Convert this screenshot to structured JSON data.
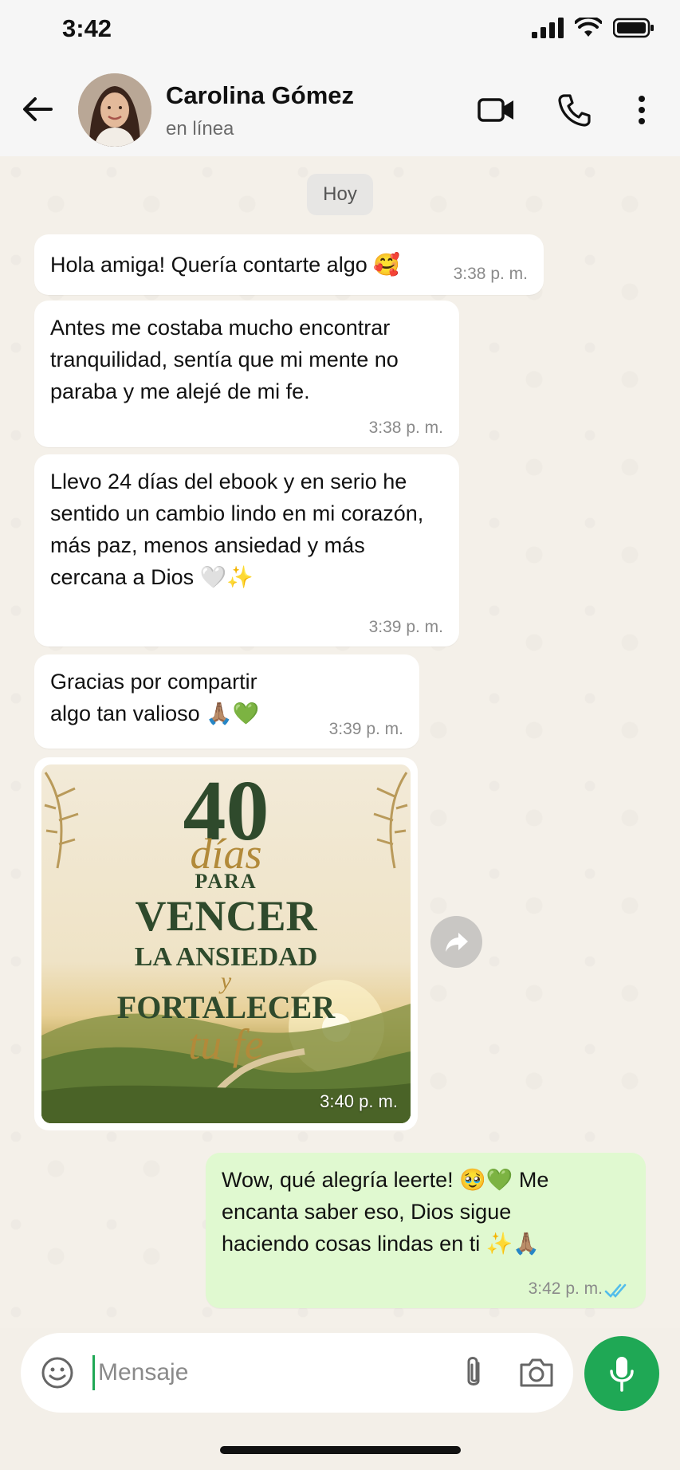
{
  "status_bar": {
    "time": "3:42"
  },
  "header": {
    "contact_name": "Carolina Gómez",
    "contact_status": "en línea"
  },
  "date_chip": "Hoy",
  "messages": [
    {
      "text": "Hola amiga! Quería contarte algo 🥰",
      "time": "3:38 p. m.",
      "direction": "in"
    },
    {
      "text": "Antes me costaba mucho encontrar tranquilidad, sentía que mi mente no paraba y me alejé de mi fe.",
      "time": "3:38 p. m.",
      "direction": "in"
    },
    {
      "text": "Llevo 24 días del ebook y en serio he sentido un cambio lindo en mi corazón, más paz, menos ansiedad y más cercana a Dios 🤍✨",
      "time": "3:39 p. m.",
      "direction": "in"
    },
    {
      "text": "Gracias por compartir algo tan valioso 🙏🏽💚",
      "time": "3:39 p. m.",
      "direction": "in"
    },
    {
      "text": "Wow, qué alegría leerte! 🥹💚 Me encanta saber eso, Dios sigue haciendo cosas lindas en ti ✨🙏🏽",
      "time": "3:42 p. m.",
      "direction": "out",
      "read": true
    }
  ],
  "image_message": {
    "cover": {
      "number": "40",
      "word_dias": "días",
      "word_para": "PARA",
      "word_vencer": "VENCER",
      "word_ansiedad": "LA ANSIEDAD",
      "word_y": "y",
      "word_fortalecer": "FORTALECER",
      "word_tufe": "tu fe"
    },
    "time": "3:40 p. m."
  },
  "composer": {
    "placeholder": "Mensaje"
  },
  "colors": {
    "accent": "#1fa855",
    "outgoing_bubble": "#e0f9d0",
    "read_ticks": "#53bdeb"
  }
}
